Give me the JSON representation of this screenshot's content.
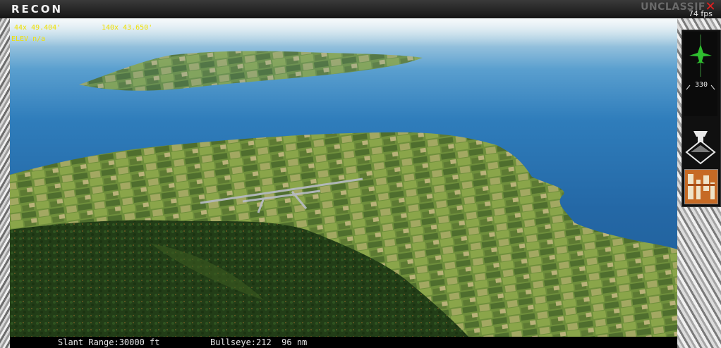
{
  "window": {
    "title": "RECON",
    "classification": "UNCLASSIF",
    "fps": "74 fps",
    "close_icon": "close-icon"
  },
  "overlay": {
    "latitude": "44x 49.404'",
    "longitude": "140x 43.650'",
    "elevation": "ELEV n/a"
  },
  "status": {
    "slant_range": "Slant Range:30000 ft",
    "bullseye": "Bullseye:212  96 nm"
  },
  "panel": {
    "heading": "330",
    "icons": [
      "aircraft-icon",
      "camera-mode-icon",
      "map-thumbnail-icon"
    ]
  },
  "colors": {
    "overlay_text": "#f0e000",
    "close": "#e02020",
    "sea": "#2468a6",
    "land": "#6f8f3c"
  }
}
